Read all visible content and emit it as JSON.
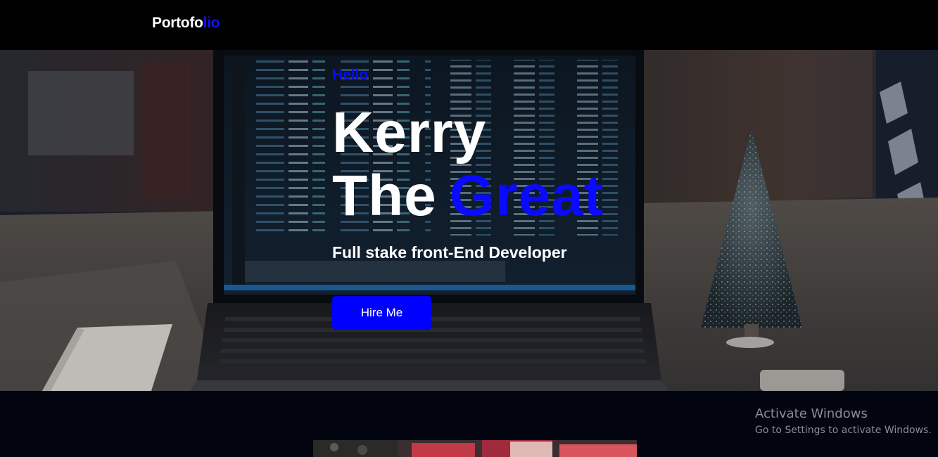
{
  "nav": {
    "logo_main": "Portofo",
    "logo_accent": "lio"
  },
  "hero": {
    "greeting": "Hello",
    "name_line1": "Kerry",
    "name_line2": "The",
    "name_accent": "Great",
    "subtitle": "Full stake front-End Developer",
    "hire_button": "Hire Me",
    "background_image": "laptop-code-christmas-tree-photo"
  },
  "next_section": {
    "image": "section-preview-photo"
  },
  "watermark": {
    "title": "Activate Windows",
    "subtitle": "Go to Settings to activate Windows."
  },
  "colors": {
    "accent": "#0a0aff",
    "nav_bg": "#000000",
    "page_bg": "#02040f",
    "text": "#ffffff"
  }
}
